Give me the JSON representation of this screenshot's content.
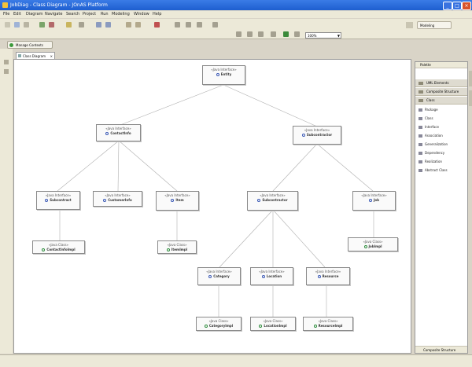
{
  "window": {
    "title": "JobDiag - Class Diagram - JOnAS Platform"
  },
  "menu": [
    "File",
    "Edit",
    "Diagram",
    "Navigate",
    "Search",
    "Project",
    "Run",
    "Modeling",
    "Window",
    "Help"
  ],
  "toolbar": {
    "zoom_value": "100%",
    "perspective_label": "Modeling"
  },
  "manage_button": {
    "label": "Manage Contexts"
  },
  "editor_tab": {
    "label": "Class Diagram"
  },
  "palette": {
    "header": "Palette",
    "drawers": [
      "UML Elements",
      "Composite Structure",
      "Class"
    ],
    "items": [
      "Package",
      "Class",
      "Interface",
      "Association",
      "Generalization",
      "Dependency",
      "Realization",
      "Abstract Class"
    ],
    "footer": "Composite Structure"
  },
  "diagram": {
    "nodes": [
      {
        "stereo": "«Java Interface»",
        "name": "Entity",
        "kind": "interface"
      },
      {
        "stereo": "«Java Interface»",
        "name": "ContactInfo",
        "kind": "interface"
      },
      {
        "stereo": "«Java Interface»",
        "name": "Subcontractor",
        "kind": "interface"
      },
      {
        "stereo": "«Java Interface»",
        "name": "Subcontract",
        "kind": "interface"
      },
      {
        "stereo": "«Java Interface»",
        "name": "CustomerInfo",
        "kind": "interface"
      },
      {
        "stereo": "«Java Interface»",
        "name": "Item",
        "kind": "interface"
      },
      {
        "stereo": "«Java Interface»",
        "name": "Subcontractor",
        "kind": "interface"
      },
      {
        "stereo": "«Java Interface»",
        "name": "Job",
        "kind": "interface"
      },
      {
        "stereo": "«Java Class»",
        "name": "ContactInfoImpl",
        "kind": "class"
      },
      {
        "stereo": "«Java Class»",
        "name": "ItemImpl",
        "kind": "class"
      },
      {
        "stereo": "«Java Class»",
        "name": "JobImpl",
        "kind": "class"
      },
      {
        "stereo": "«Java Interface»",
        "name": "Category",
        "kind": "interface"
      },
      {
        "stereo": "«Java Interface»",
        "name": "Location",
        "kind": "interface"
      },
      {
        "stereo": "«Java Interface»",
        "name": "Resource",
        "kind": "interface"
      },
      {
        "stereo": "«Java Class»",
        "name": "CategoryImpl",
        "kind": "class"
      },
      {
        "stereo": "«Java Class»",
        "name": "LocationImpl",
        "kind": "class"
      },
      {
        "stereo": "«Java Class»",
        "name": "ResourceImpl",
        "kind": "class"
      }
    ]
  }
}
